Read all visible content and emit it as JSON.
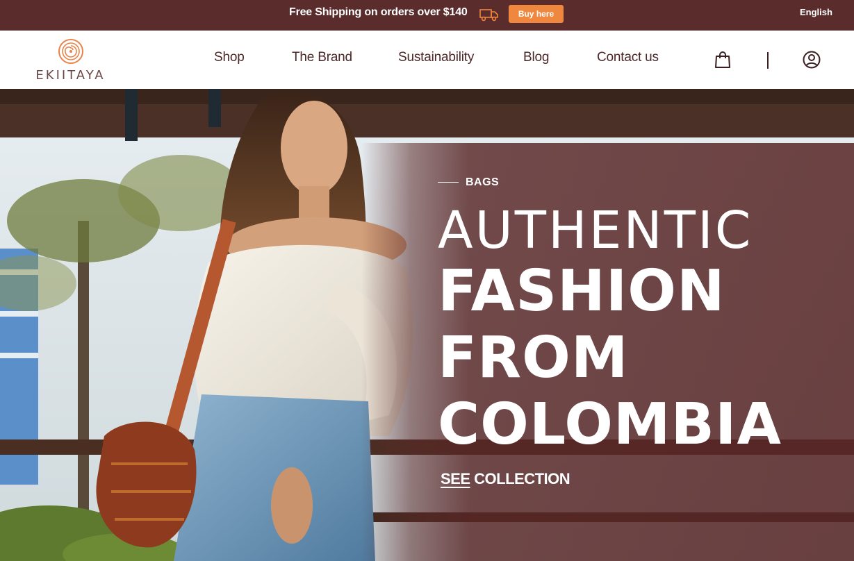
{
  "topbar": {
    "shipping_text": "Free Shipping on orders over $140",
    "truck_icon": "truck-icon",
    "buy_label": "Buy here",
    "language": "English"
  },
  "header": {
    "logo_text": "EKIITAYA",
    "nav": [
      {
        "label": "Shop"
      },
      {
        "label": "The Brand"
      },
      {
        "label": "Sustainability"
      },
      {
        "label": "Blog"
      },
      {
        "label": "Contact us"
      }
    ],
    "cart_icon": "shopping-bag-icon",
    "account_icon": "user-icon"
  },
  "hero": {
    "eyebrow": "BAGS",
    "line1": "AUTHENTIC",
    "line2": "FASHION",
    "line3": "FROM",
    "line4": "COLOMBIA",
    "cta_see": "SEE",
    "cta_collection": "COLLECTION"
  },
  "colors": {
    "brand_dark": "#5a2c2c",
    "accent": "#f0873f",
    "nav_text": "#4b2727",
    "logo_orange": "#e8844a"
  }
}
